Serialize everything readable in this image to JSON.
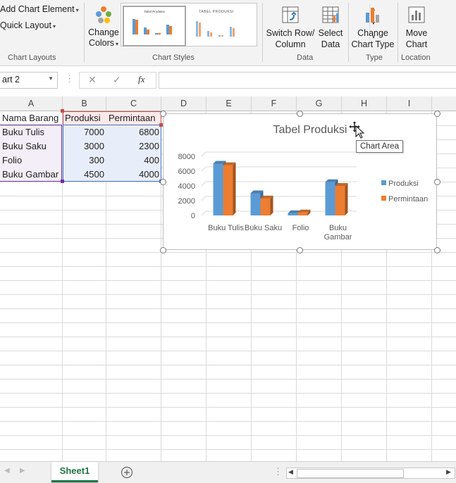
{
  "ribbon": {
    "add_chart_element": "Add Chart Element",
    "quick_layout": "Quick Layout",
    "change_colors": [
      "Change",
      "Colors"
    ],
    "chart_layouts_label": "Chart Layouts",
    "chart_styles_label": "Chart Styles",
    "switch_row_column": [
      "Switch Row/",
      "Column"
    ],
    "select_data": [
      "Select",
      "Data"
    ],
    "data_label": "Data",
    "change_chart_type": [
      "Change",
      "Chart Type"
    ],
    "type_label": "Type",
    "move_chart": [
      "Move",
      "Chart"
    ],
    "location_label": "Location",
    "gallery_thumb1_title": "Tabel Produksi",
    "gallery_thumb2_title": "TABEL PRODUKSI"
  },
  "formula_bar": {
    "name_box": "art 2",
    "cancel": "✕",
    "enter": "✓",
    "fx": "fx",
    "value": ""
  },
  "columns": [
    "A",
    "B",
    "C",
    "D",
    "E",
    "F",
    "G",
    "H",
    "I"
  ],
  "table": {
    "headers": [
      "Nama Barang",
      "Produksi",
      "Permintaan"
    ],
    "rows": [
      [
        "Buku Tulis",
        "7000",
        "6800"
      ],
      [
        "Buku Saku",
        "3000",
        "2300"
      ],
      [
        "Folio",
        "300",
        "400"
      ],
      [
        "Buku Gambar",
        "4500",
        "4000"
      ]
    ]
  },
  "chart_data": {
    "type": "bar",
    "title": "Tabel Produksi",
    "categories": [
      "Buku Tulis",
      "Buku Saku",
      "Folio",
      "Buku Gambar"
    ],
    "series": [
      {
        "name": "Produksi",
        "values": [
          7000,
          3000,
          300,
          4500
        ],
        "color": "#5b9bd5"
      },
      {
        "name": "Permintaan",
        "values": [
          6800,
          2300,
          400,
          4000
        ],
        "color": "#ed7d31"
      }
    ],
    "yticks": [
      "8000",
      "6000",
      "4000",
      "2000",
      "0"
    ],
    "ylim": [
      0,
      8000
    ],
    "legend_position": "right",
    "style": "3-D clustered column",
    "category_label_lines": [
      [
        "Buku Tulis"
      ],
      [
        "Buku Saku"
      ],
      [
        "Folio"
      ],
      [
        "Buku",
        "Gambar"
      ]
    ]
  },
  "tooltip": "Chart Area",
  "sheet_tab": "Sheet1",
  "colors": {
    "accent_green": "#217346",
    "selection_purple": "#7030a0",
    "selection_red": "#c0504d",
    "selection_blue": "#4472c4"
  }
}
